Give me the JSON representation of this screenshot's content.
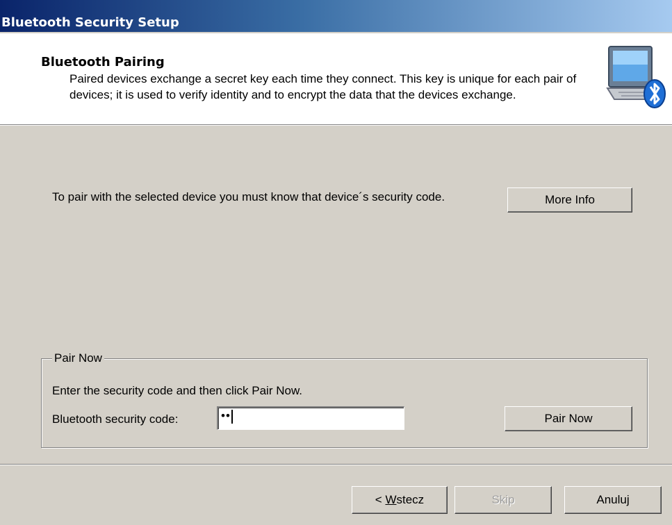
{
  "window": {
    "title": "Bluetooth Security Setup"
  },
  "header": {
    "title": "Bluetooth Pairing",
    "description": "Paired devices exchange a secret key each time they connect. This key is unique for each pair of devices; it is used to verify identity and to encrypt the data that the devices exchange.",
    "icon": "bluetooth-computer-icon"
  },
  "body": {
    "info_text": "To pair with the selected device you must know that device´s security code.",
    "more_info_label": "More Info"
  },
  "pair_group": {
    "legend": "Pair Now",
    "instruction": "Enter the security code and then click Pair Now.",
    "code_label": "Bluetooth security code:",
    "code_value": "••",
    "pair_now_label": "Pair Now"
  },
  "footer": {
    "back_label_prefix": "< ",
    "back_label_mnemonic": "W",
    "back_label_rest": "stecz",
    "skip_label": "Skip",
    "cancel_label": "Anuluj"
  },
  "colors": {
    "titlebar_start": "#0a246a",
    "titlebar_end": "#a6caf0",
    "dialog_bg": "#d4d0c8"
  }
}
